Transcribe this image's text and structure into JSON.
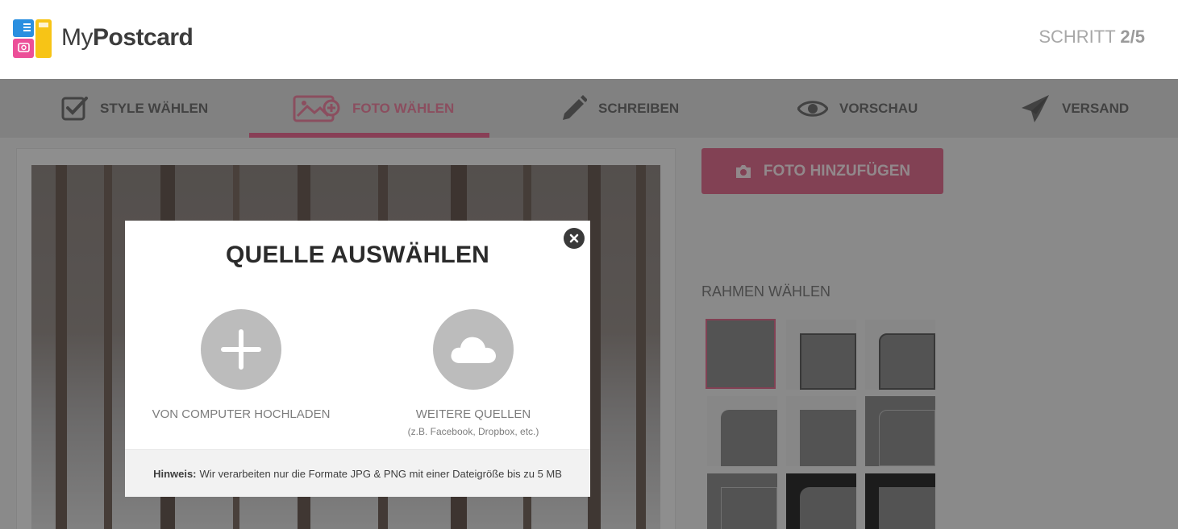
{
  "header": {
    "brand_prefix": "My",
    "brand_bold": "Postcard",
    "step_label": "SCHRITT",
    "step_value": "2/5"
  },
  "nav": {
    "items": [
      {
        "label": "STYLE WÄHLEN",
        "icon": "checkbox-icon"
      },
      {
        "label": "FOTO WÄHLEN",
        "icon": "add-photo-icon",
        "active": true
      },
      {
        "label": "SCHREIBEN",
        "icon": "pencil-icon"
      },
      {
        "label": "VORSCHAU",
        "icon": "eye-icon"
      },
      {
        "label": "VERSAND",
        "icon": "paper-plane-icon"
      }
    ],
    "active_color": "#e3698f"
  },
  "sidebar": {
    "add_photo_label": "FOTO HINZUFÜGEN",
    "frames_title": "RAHMEN WÄHLEN"
  },
  "modal": {
    "title": "QUELLE AUSWÄHLEN",
    "sources": [
      {
        "label": "VON COMPUTER HOCHLADEN",
        "sub": "",
        "icon": "plus-icon"
      },
      {
        "label": "WEITERE QUELLEN",
        "sub": "(z.B. Facebook, Dropbox, etc.)",
        "icon": "cloud-icon"
      }
    ],
    "hint_label": "Hinweis:",
    "hint_text": "Wir verarbeiten nur die Formate JPG & PNG mit einer Dateigröße bis zu 5 MB"
  },
  "colors": {
    "brand_pink": "#d96d8d",
    "logo_blue": "#2b8fe0",
    "logo_yellow": "#f7c416",
    "logo_pink": "#ec4f98"
  }
}
